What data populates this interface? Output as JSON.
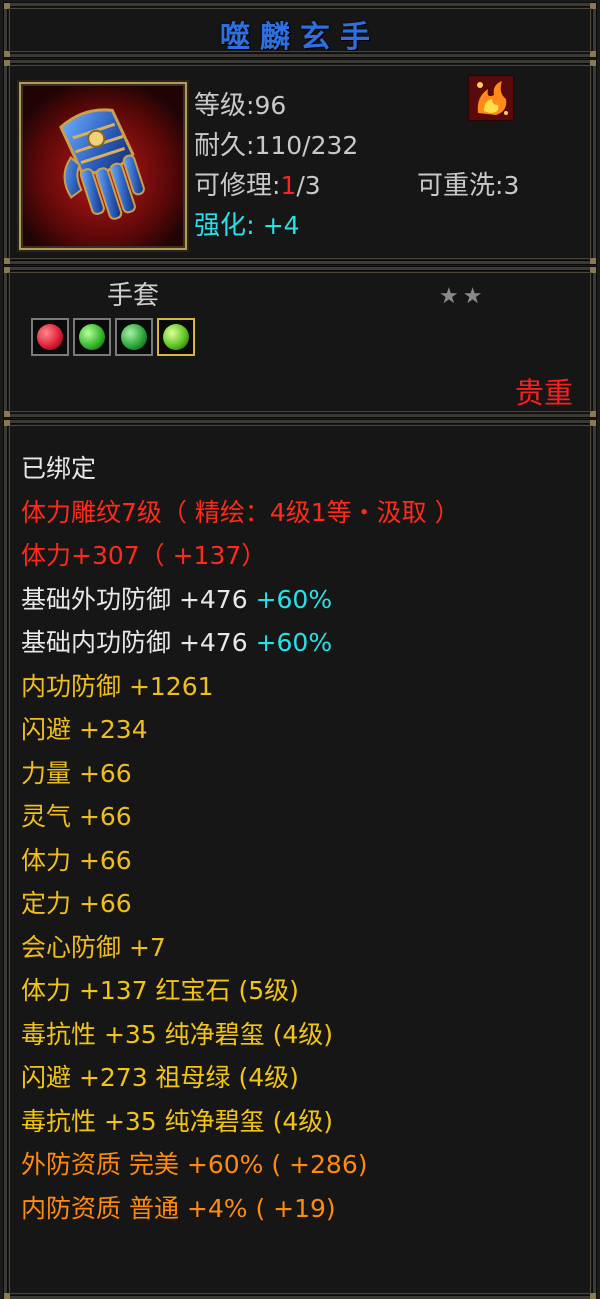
{
  "item": {
    "name": "噬麟玄手",
    "level_label": "等级",
    "level_value": ":96",
    "durability_label": "耐久",
    "durability_value": ":110/232",
    "repair_label": "可修理",
    "repair_sep": ":",
    "repair_used": "1",
    "repair_total": "/3",
    "rewash_label": "可重洗",
    "rewash_value": ":3",
    "enhance_label": "强化:",
    "enhance_value": " +4",
    "type": "手套",
    "stars": [
      "★",
      "★"
    ],
    "rarity": "贵重"
  },
  "gems": [
    {
      "color": "#e0203a",
      "border": "gray"
    },
    {
      "color": "#38b82e",
      "border": "gray"
    },
    {
      "color": "#2ea83a",
      "border": "gray"
    },
    {
      "color": "#5cc424",
      "border": "gold"
    }
  ],
  "stats": {
    "bound": "已绑定",
    "engraving": "体力雕纹7级（ 精绘：4级1等・汲取 ）",
    "stamina_base": "体力+307（ +137）",
    "outer_def": "基础外功防御 +476 ",
    "outer_def_pct": "+60%",
    "inner_def": "基础内功防御 +476 ",
    "inner_def_pct": "+60%",
    "lines": [
      "内功防御 +1261",
      "闪避 +234",
      "力量 +66",
      "灵气 +66",
      "体力 +66",
      "定力 +66",
      "会心防御 +7"
    ],
    "gem_lines": [
      "体力 +137 红宝石 (5级)",
      "毒抗性 +35 纯净碧玺 (4级)",
      "闪避 +273 祖母绿 (4级)",
      "毒抗性 +35 纯净碧玺 (4级)"
    ],
    "quality_lines": [
      "外防资质   完美 +60% ( +286)",
      "内防资质   普通 +4% ( +19)"
    ]
  },
  "colors": {
    "title": "#2f6fe0",
    "cyan": "#28e0e8",
    "red": "#ff2a1a",
    "gold": "#f0bd1e",
    "orange": "#ff8a10"
  }
}
